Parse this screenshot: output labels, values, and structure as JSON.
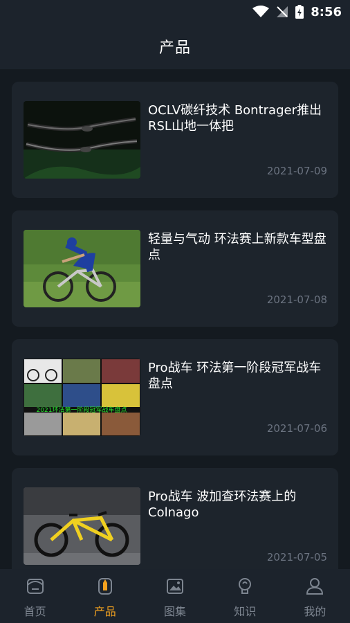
{
  "status_bar": {
    "time": "8:56"
  },
  "header": {
    "title": "产品"
  },
  "articles": [
    {
      "title": "OCLV碳纤技术 Bontrager推出RSL山地一体把",
      "date": "2021-07-09"
    },
    {
      "title": "轻量与气动 环法赛上新款车型盘点",
      "date": "2021-07-08"
    },
    {
      "title": "Pro战车 环法第一阶段冠军战车盘点",
      "date": "2021-07-06",
      "image_caption": "2021环法第一阶段冠军战车盘点"
    },
    {
      "title": "Pro战车 波加查环法赛上的Colnago",
      "date": "2021-07-05"
    }
  ],
  "bottom_nav": {
    "items": [
      {
        "label": "首页",
        "icon": "home-icon"
      },
      {
        "label": "产品",
        "icon": "product-icon",
        "active": true
      },
      {
        "label": "图集",
        "icon": "gallery-icon"
      },
      {
        "label": "知识",
        "icon": "knowledge-icon"
      },
      {
        "label": "我的",
        "icon": "profile-icon"
      }
    ]
  },
  "colors": {
    "accent": "#f2a11f",
    "background": "#151a21",
    "card": "#1d242c",
    "muted": "#7d8590"
  }
}
